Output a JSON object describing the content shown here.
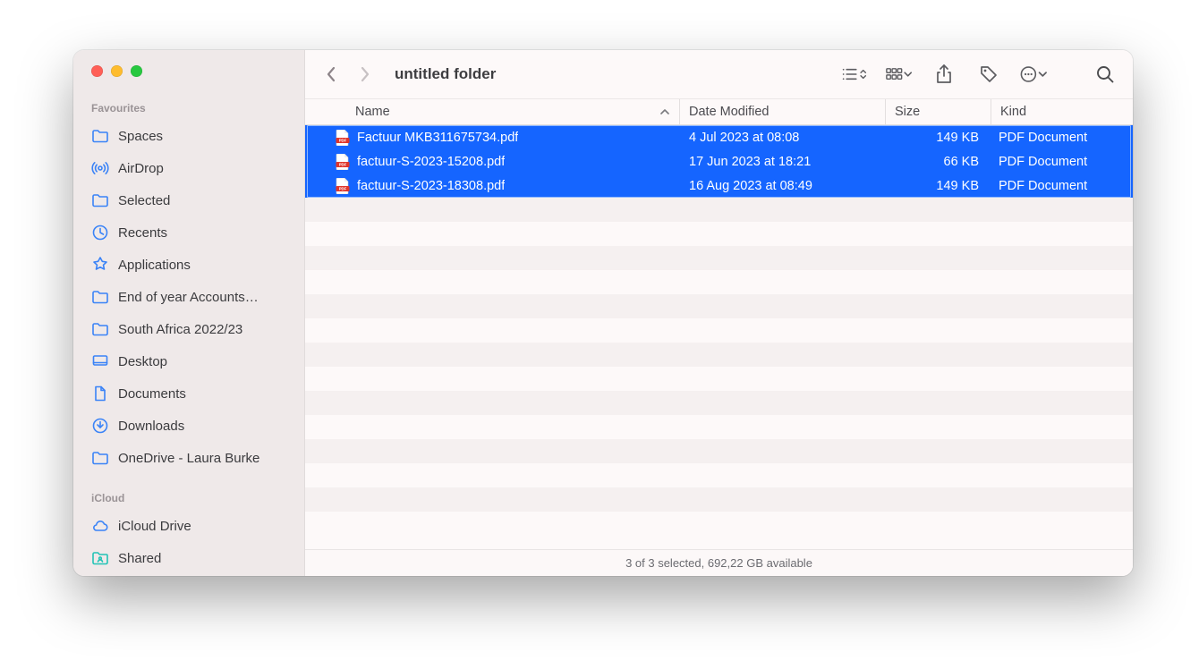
{
  "window": {
    "title": "untitled folder"
  },
  "sidebar": {
    "sections": [
      {
        "label": "Favourites",
        "items": [
          {
            "icon": "folder",
            "label": "Spaces"
          },
          {
            "icon": "airdrop",
            "label": "AirDrop"
          },
          {
            "icon": "folder",
            "label": "Selected"
          },
          {
            "icon": "clock",
            "label": "Recents"
          },
          {
            "icon": "apps",
            "label": "Applications"
          },
          {
            "icon": "folder",
            "label": "End of year Accounts…"
          },
          {
            "icon": "folder",
            "label": "South Africa 2022/23"
          },
          {
            "icon": "desktop",
            "label": "Desktop"
          },
          {
            "icon": "doc",
            "label": "Documents"
          },
          {
            "icon": "download",
            "label": "Downloads"
          },
          {
            "icon": "folder",
            "label": "OneDrive - Laura Burke"
          }
        ]
      },
      {
        "label": "iCloud",
        "items": [
          {
            "icon": "cloud",
            "label": "iCloud Drive"
          },
          {
            "icon": "shared",
            "label": "Shared",
            "iconColor": "teal"
          }
        ]
      }
    ]
  },
  "columns": {
    "name": "Name",
    "date": "Date Modified",
    "size": "Size",
    "kind": "Kind"
  },
  "files": [
    {
      "name": "Factuur MKB311675734.pdf",
      "date": "4 Jul 2023 at 08:08",
      "size": "149 KB",
      "kind": "PDF Document",
      "selected": true
    },
    {
      "name": "factuur-S-2023-15208.pdf",
      "date": "17 Jun 2023 at 18:21",
      "size": "66 KB",
      "kind": "PDF Document",
      "selected": true
    },
    {
      "name": "factuur-S-2023-18308.pdf",
      "date": "16 Aug 2023 at 08:49",
      "size": "149 KB",
      "kind": "PDF Document",
      "selected": true
    }
  ],
  "empty_rows": 14,
  "status": "3 of 3 selected, 692,22 GB available"
}
